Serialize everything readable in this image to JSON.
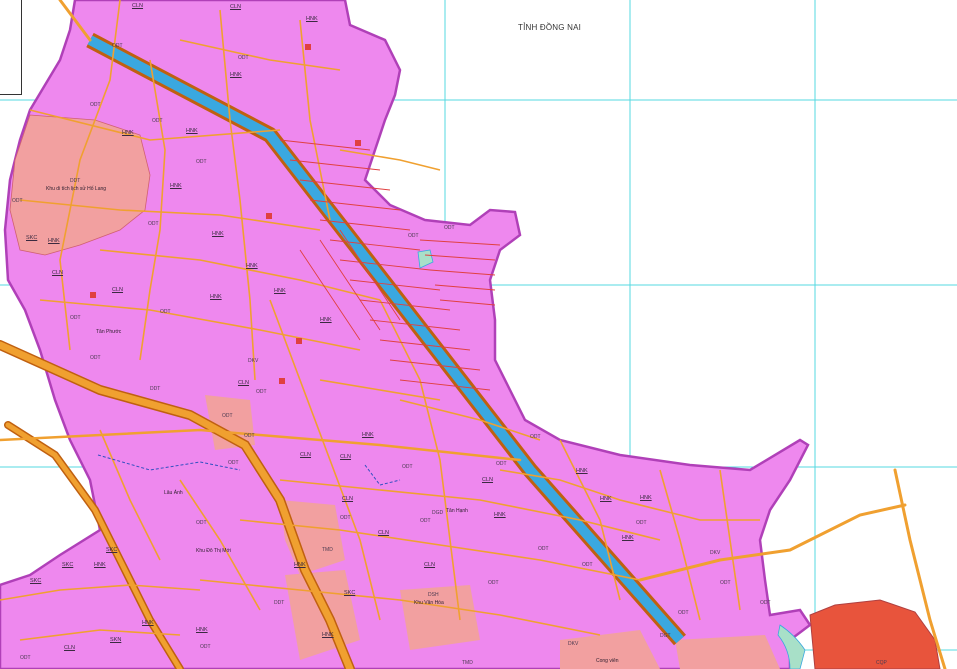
{
  "map": {
    "region_label": "TỈNH ĐỒNG NAI",
    "colors": {
      "urban_land": "#ee88ee",
      "urban_land_edge": "#b040b8",
      "historic_area": "#f2a0a0",
      "lake_green": "#a8e0c8",
      "river_blue": "#3aa8e0",
      "road_orange": "#f0a030",
      "road_edge": "#c06010",
      "grid_cyan": "#56d8e0",
      "forest_red": "#e8543c",
      "block_red": "#e04040"
    },
    "areas": [
      {
        "code": "CLN",
        "name": ""
      },
      {
        "code": "DDT",
        "name": "Khu di tích lịch sử Hố Lang"
      },
      {
        "code": "ODT",
        "name": ""
      },
      {
        "code": "DDT",
        "name": "Cong vien"
      }
    ],
    "labels": {
      "l1": "CLN",
      "l2": "ODT",
      "l3": "HNK",
      "l4": "ODT",
      "l5": "HNK",
      "l6": "ODT",
      "l7": "HNK",
      "l8": "ODT",
      "l9": "CLN",
      "l10": "HNK",
      "l11": "ODT",
      "l12": "DDT",
      "l13": "Khu di tích lịch sử Hố Lang",
      "l14": "ODT",
      "l15": "HNK",
      "l16": "HNK",
      "l17": "ODT",
      "l18": "CLN",
      "l19": "ODT",
      "l20": "HNK",
      "l21": "SKC",
      "l22": "HNK",
      "l23": "CLN",
      "l24": "ODT",
      "l25": "HNK",
      "l26": "ODT",
      "l27": "ODT",
      "l28": "CLN",
      "l29": "ODT",
      "l30": "HNK",
      "l31": "ODT",
      "l32": "DKV",
      "l33": "CLN",
      "l34": "ODT",
      "l35": "HNK",
      "l36": "CLN",
      "l37": "ODT",
      "l38": "HNK",
      "l39": "SKC",
      "l40": "HNK",
      "l41": "CLN",
      "l42": "TMD",
      "l43": "SKC",
      "l44": "HNK",
      "l45": "CLN",
      "l46": "SKC",
      "l47": "ODT",
      "l48": "HNK",
      "l49": "SKN",
      "l50": "HNK",
      "l51": "HNK",
      "l52": "ODT",
      "l53": "CLN",
      "l54": "HNK",
      "l55": "ODT",
      "l56": "HNK",
      "l57": "ODT",
      "l58": "HNK",
      "l59": "ODT",
      "l60": "HNK",
      "l61": "ODT",
      "l62": "DKV",
      "l63": "HNK",
      "l64": "ODT",
      "l65": "ODT",
      "l66": "ODT",
      "l67": "DGT",
      "l68": "Cong viên",
      "l69": "DSH",
      "l70": "Khu Văn Hóa",
      "l71": "ODT",
      "l72": "CLN",
      "l73": "SKC",
      "l74": "DDT",
      "l75": "ODT",
      "l76": "DGD",
      "l77": "TMD",
      "l78": "DKV",
      "l79": "ODT",
      "l80": "ODT",
      "l81": "CQP",
      "l82": "ODT",
      "l83": "Tân Phước",
      "l84": "Khu Đô Thị Mới",
      "l85": "Lâu Ánh",
      "l86": "Tân Hạnh",
      "l87": "DDT",
      "l88": "ODT",
      "l89": "CLN",
      "l90": "ODT"
    }
  }
}
